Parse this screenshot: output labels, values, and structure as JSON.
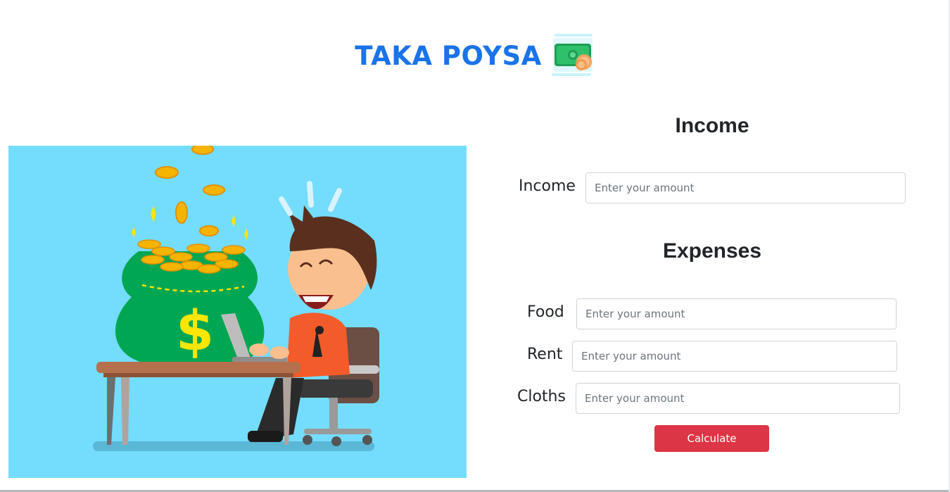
{
  "header": {
    "title": "TAKA POYSA",
    "icon": "money-icon"
  },
  "hero": {
    "icon": "money-bag-businessman-illustration"
  },
  "income_section": {
    "heading": "Income",
    "fields": [
      {
        "label": "Income",
        "placeholder": "Enter your amount",
        "value": ""
      }
    ]
  },
  "expenses_section": {
    "heading": "Expenses",
    "fields": [
      {
        "label": "Food",
        "placeholder": "Enter your amount",
        "value": ""
      },
      {
        "label": "Rent",
        "placeholder": "Enter your amount",
        "value": ""
      },
      {
        "label": "Cloths",
        "placeholder": "Enter your amount",
        "value": ""
      }
    ]
  },
  "actions": {
    "calculate_label": "Calculate"
  },
  "colors": {
    "title": "#1a73e8",
    "hero_background": "#74dcfc",
    "button": "#dc3545"
  }
}
